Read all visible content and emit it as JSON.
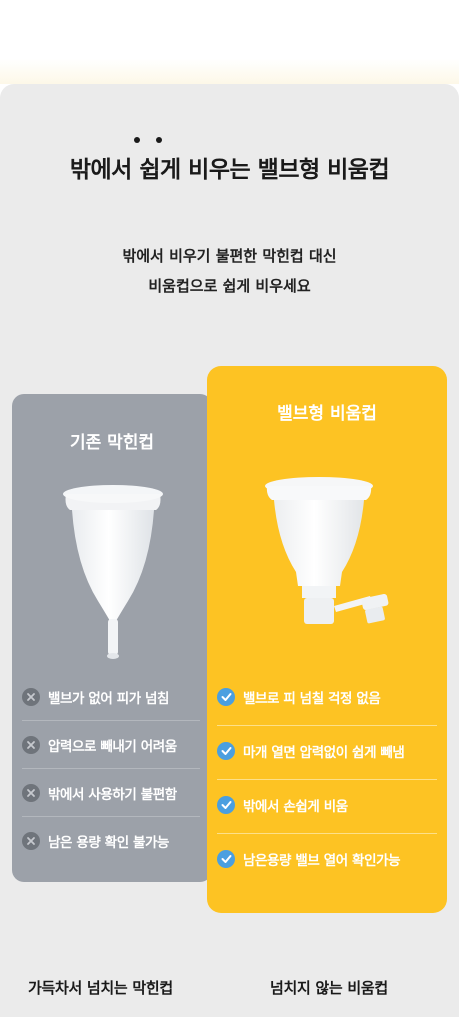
{
  "header": {
    "title": "밖에서 쉽게 비우는 밸브형 비움컵",
    "subtitle_line1": "밖에서 비우기 불편한 막힌컵 대신",
    "subtitle_line2": "비움컵으로 쉽게 비우세요"
  },
  "comparison": {
    "old": {
      "title": "기존 막힌컵",
      "icon": "x-circle-icon",
      "items": [
        "밸브가 없어 피가 넘침",
        "압력으로 빼내기 어려움",
        "밖에서 사용하기 불편함",
        "남은 용량 확인 불가능"
      ],
      "caption": "가득차서 넘치는 막힌컵"
    },
    "new": {
      "title": "밸브형 비움컵",
      "icon": "check-circle-icon",
      "items": [
        "밸브로 피 넘칠 걱정 없음",
        "마개 열면 압력없이 쉽게 빼냄",
        "밖에서 손쉽게 비움",
        "남은용량 밸브 열어 확인가능"
      ],
      "caption": "넘치지 않는 비움컵"
    }
  },
  "colors": {
    "panel_bg": "#ebebeb",
    "old_card": "#9ca1a9",
    "new_card": "#fdc323",
    "check_icon": "#4a9fe0",
    "x_icon": "#6f747b"
  }
}
